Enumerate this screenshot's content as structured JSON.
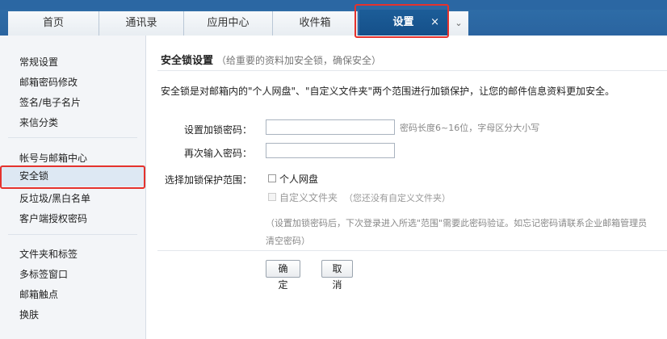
{
  "tabs": [
    {
      "label": "首页"
    },
    {
      "label": "通讯录"
    },
    {
      "label": "应用中心"
    },
    {
      "label": "收件箱"
    },
    {
      "label": "设置",
      "active": true,
      "close": "×"
    }
  ],
  "tab_more": "⌄",
  "sidebar": {
    "group1": [
      "常规设置",
      "邮箱密码修改",
      "签名/电子名片",
      "来信分类"
    ],
    "group2": [
      "帐号与邮箱中心",
      "安全锁",
      "反垃圾/黑白名单",
      "客户端授权密码"
    ],
    "group3": [
      "文件夹和标签",
      "多标签窗口",
      "邮箱触点",
      "换肤"
    ],
    "active": "安全锁"
  },
  "main": {
    "title": "安全锁设置",
    "subtitle": "（给重要的资料加安全锁，确保安全）",
    "description": "安全锁是对邮箱内的\"个人网盘\"、\"自定义文件夹\"两个范围进行加锁保护，让您的邮件信息资料更加安全。",
    "password_label": "设置加锁密码：",
    "password_value": "",
    "password_hint": "密码长度6~16位，字母区分大小写",
    "confirm_label": "再次输入密码：",
    "confirm_value": "",
    "scope_label": "选择加锁保护范围：",
    "scope_option1": "个人网盘",
    "scope_option2": "自定义文件夹",
    "scope_option2_note": "（您还没有自定义文件夹）",
    "note": "（设置加锁密码后，下次登录进入所选\"范围\"需要此密码验证。如忘记密码请联系企业邮箱管理员清空密码）",
    "confirm_button": "确 定",
    "cancel_button": "取消"
  },
  "colors": {
    "accent": "#1c5d98",
    "highlight": "#e5322d",
    "sidebar_bg": "#f3f5f8"
  }
}
